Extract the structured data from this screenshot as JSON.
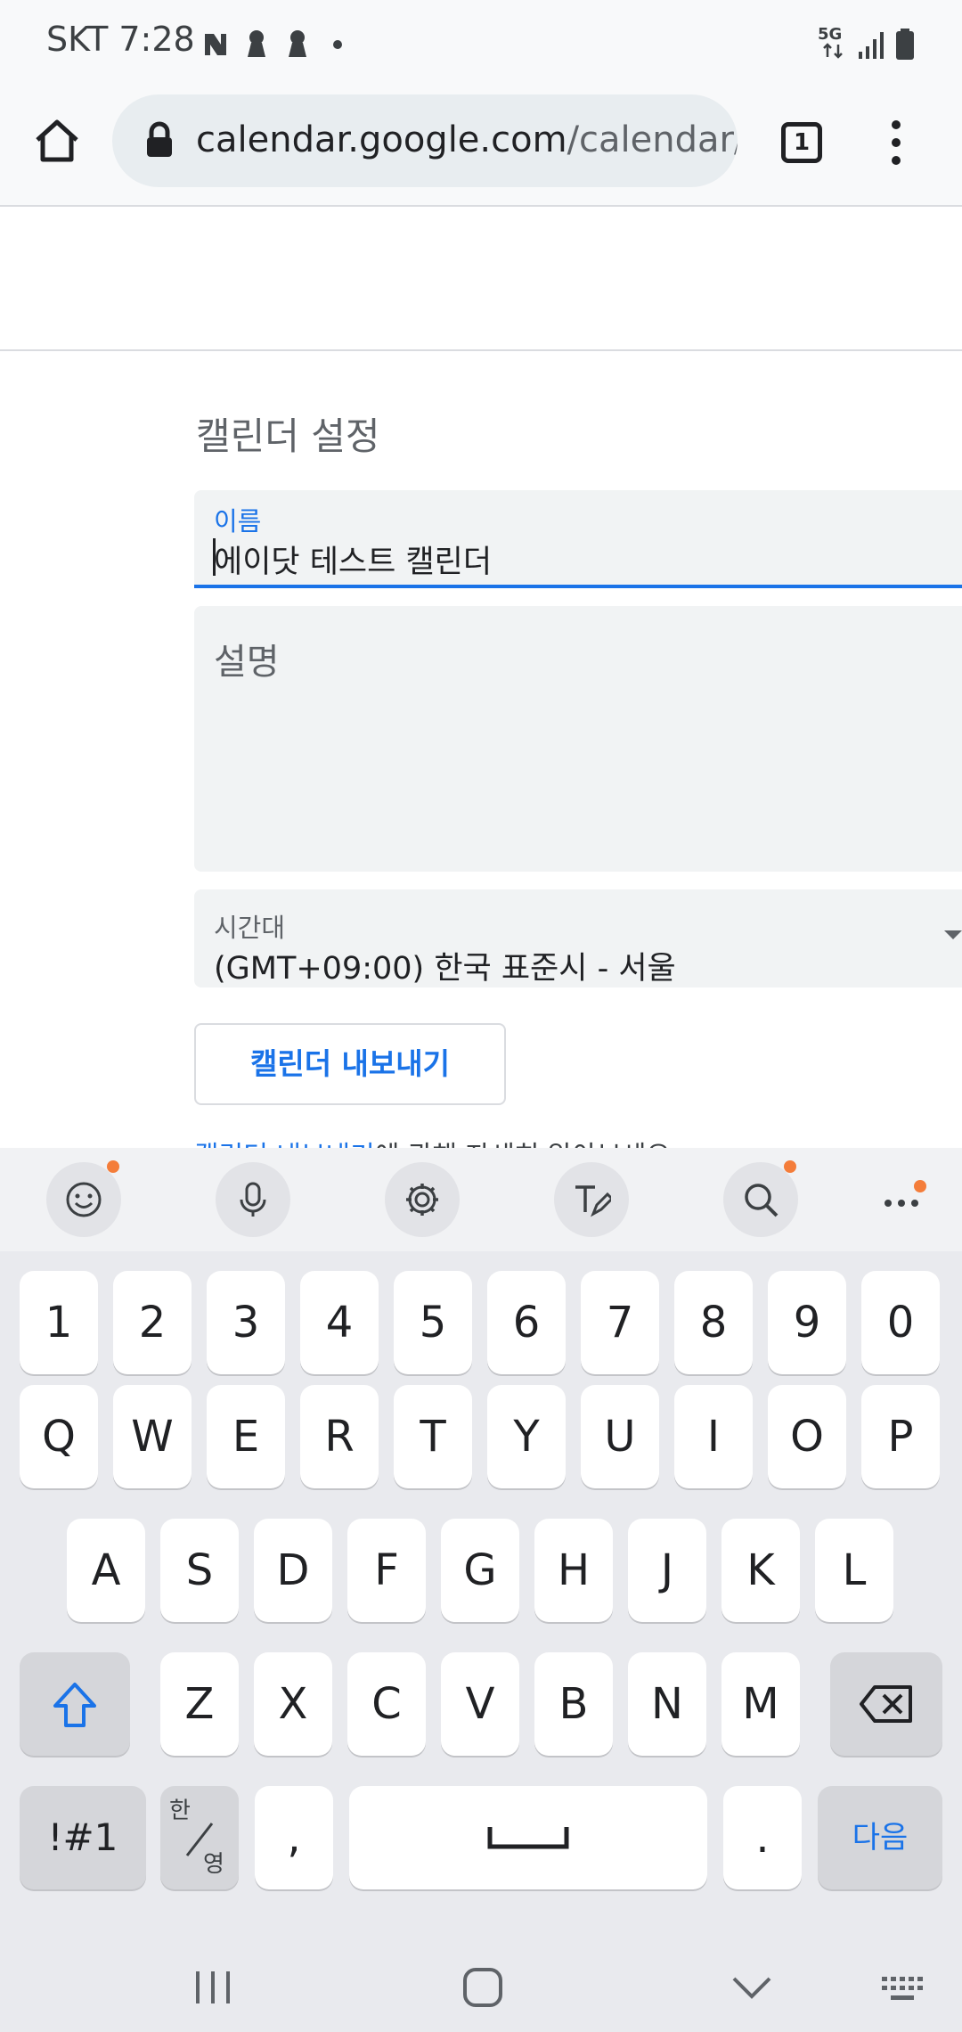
{
  "status_bar": {
    "carrier_time": "SKT 7:28",
    "network_badge": "5G",
    "icons": [
      "naver-icon",
      "keyhole-icon",
      "keyhole-icon",
      "dot-icon",
      "5g-icon",
      "signal-icon",
      "battery-icon"
    ]
  },
  "browser": {
    "url_host": "calendar.google.com",
    "url_path": "/calendar/",
    "tab_count": "1"
  },
  "page": {
    "section_title": "캘린더 설정",
    "name_field": {
      "label": "이름",
      "value": "에이닷 테스트 캘린더"
    },
    "description_field": {
      "placeholder": "설명"
    },
    "timezone_field": {
      "label": "시간대",
      "value": "(GMT+09:00) 한국 표준시 - 서울"
    },
    "export_button": "캘린더 내보내기",
    "help_link": "캘린더 내보내기",
    "help_text": "에 관해 자세히 알아보세요."
  },
  "colors": {
    "accent": "#1a73e8",
    "field_bg": "#f1f3f4",
    "keyboard_bg": "#e9eaee",
    "notification_dot": "#f47d3a"
  },
  "keyboard": {
    "toolbar_icons": [
      "emoji-icon",
      "microphone-icon",
      "settings-icon",
      "handwriting-icon",
      "search-icon",
      "more-icon"
    ],
    "row_numbers": [
      "1",
      "2",
      "3",
      "4",
      "5",
      "6",
      "7",
      "8",
      "9",
      "0"
    ],
    "row_top": [
      "Q",
      "W",
      "E",
      "R",
      "T",
      "Y",
      "U",
      "I",
      "O",
      "P"
    ],
    "row_middle": [
      "A",
      "S",
      "D",
      "F",
      "G",
      "H",
      "J",
      "K",
      "L"
    ],
    "row_bottom": [
      "Z",
      "X",
      "C",
      "V",
      "B",
      "N",
      "M"
    ],
    "symbols_key": "!#1",
    "lang_key_top": "한",
    "lang_key_bottom": "영",
    "comma_key": ",",
    "period_key": ".",
    "next_key": "다음"
  },
  "navigation": [
    "recent-apps-icon",
    "home-icon",
    "back-icon",
    "keyboard-icon"
  ]
}
